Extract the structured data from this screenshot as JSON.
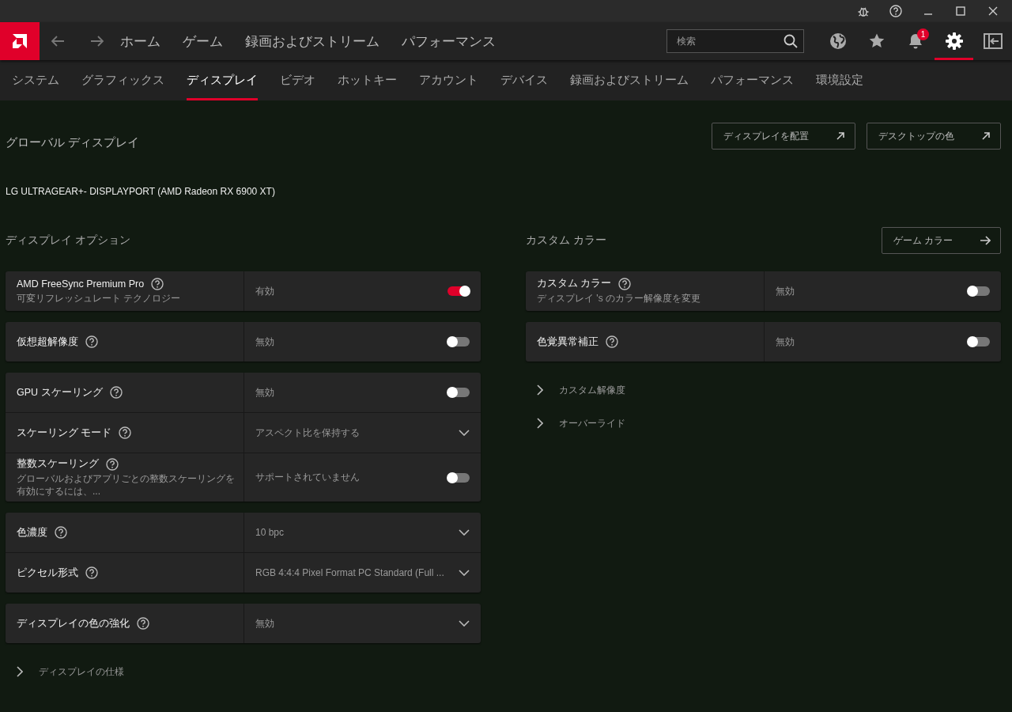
{
  "title_bar": {
    "buttons": [
      {
        "kind": "bug"
      },
      {
        "kind": "help"
      },
      {
        "kind": "minimize"
      },
      {
        "kind": "maximize"
      },
      {
        "kind": "close"
      }
    ]
  },
  "top_nav": {
    "items": [
      {
        "label": "ホーム",
        "selected": false
      },
      {
        "label": "ゲーム",
        "selected": false
      },
      {
        "label": "録画およびストリーム",
        "selected": false
      },
      {
        "label": "パフォーマンス",
        "selected": false
      }
    ],
    "search": {
      "placeholder": "検索"
    },
    "icons": [
      {
        "kind": "globe",
        "selected": false
      },
      {
        "kind": "star",
        "selected": false
      },
      {
        "kind": "bell",
        "selected": false,
        "badge": "1"
      },
      {
        "kind": "gear",
        "selected": true
      },
      {
        "kind": "exit",
        "selected": false
      }
    ]
  },
  "tabs": [
    {
      "label": "システム",
      "selected": false
    },
    {
      "label": "グラフィックス",
      "selected": false
    },
    {
      "label": "ディスプレイ",
      "selected": true
    },
    {
      "label": "ビデオ",
      "selected": false
    },
    {
      "label": "ホットキー",
      "selected": false
    },
    {
      "label": "アカウント",
      "selected": false
    },
    {
      "label": "デバイス",
      "selected": false
    },
    {
      "label": "録画およびストリーム",
      "selected": false
    },
    {
      "label": "パフォーマンス",
      "selected": false
    },
    {
      "label": "環境設定",
      "selected": false
    }
  ],
  "header": {
    "title": "グローバル ディスプレイ",
    "buttons": [
      "ディスプレイを配置",
      "デスクトップの色"
    ],
    "display_name": "LG ULTRAGEAR+- DISPLAYPORT (AMD Radeon RX 6900 XT)"
  },
  "columns": [
    {
      "title": "ディスプレイ オプション",
      "groups": [
        [
          {
            "kind": "toggle",
            "label": "AMD FreeSync Premium Pro",
            "description": "可変リフレッシュレート テクノロジー",
            "value": "有効",
            "on": true
          }
        ],
        [
          {
            "kind": "toggle",
            "label": "仮想超解像度",
            "value": "無効",
            "on": false
          }
        ],
        [
          {
            "kind": "toggle",
            "label": "GPU スケーリング",
            "value": "無効",
            "on": false
          },
          {
            "kind": "dropdown",
            "label": "スケーリング モード",
            "value": "アスペクト比を保持する"
          },
          {
            "kind": "toggle",
            "label": "整数スケーリング",
            "description": "グローバルおよびアプリごとの整数スケーリングを有効にするには、...",
            "value": "サポートされていません",
            "on": false
          }
        ],
        [
          {
            "kind": "dropdown",
            "label": "色濃度",
            "value": "10 bpc"
          },
          {
            "kind": "dropdown",
            "label": "ピクセル形式",
            "value": "RGB 4:4:4 Pixel Format PC Standard (Full ..."
          }
        ],
        [
          {
            "kind": "dropdown",
            "label": "ディスプレイの色の強化",
            "value": "無効"
          }
        ]
      ],
      "expanders": [
        "ディスプレイの仕様"
      ]
    },
    {
      "title": "カスタム カラー",
      "button": "ゲーム カラー",
      "groups": [
        [
          {
            "kind": "toggle",
            "label": "カスタム カラー",
            "description": "ディスプレイ 's のカラー解像度を変更",
            "value": "無効",
            "on": false
          }
        ],
        [
          {
            "kind": "toggle",
            "label": "色覚異常補正",
            "value": "無効",
            "on": false
          }
        ]
      ],
      "expanders": [
        "カスタム解像度",
        "オーバーライド"
      ]
    }
  ]
}
